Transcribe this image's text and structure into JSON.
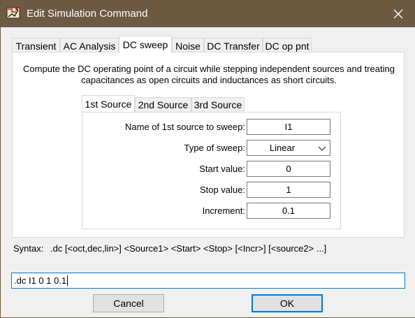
{
  "window": {
    "title": "Edit Simulation Command"
  },
  "tabs": [
    {
      "label": "Transient"
    },
    {
      "label": "AC Analysis"
    },
    {
      "label": "DC sweep"
    },
    {
      "label": "Noise"
    },
    {
      "label": "DC Transfer"
    },
    {
      "label": "DC op pnt"
    }
  ],
  "selected_tab": "DC sweep",
  "description": {
    "line1": "Compute the DC operating point of a circuit while stepping independent sources and treating",
    "line2": "capacitances as open circuits and inductances as short circuits."
  },
  "source_tabs": [
    {
      "label": "1st Source"
    },
    {
      "label": "2nd Source"
    },
    {
      "label": "3rd Source"
    }
  ],
  "selected_source_tab": "1st Source",
  "form": {
    "source_name": {
      "label": "Name of 1st source to sweep:",
      "value": "I1"
    },
    "sweep_type": {
      "label": "Type of sweep:",
      "value": "Linear"
    },
    "start": {
      "label": "Start value:",
      "value": "0"
    },
    "stop": {
      "label": "Stop value:",
      "value": "1"
    },
    "increment": {
      "label": "Increment:",
      "value": "0.1"
    }
  },
  "syntax": {
    "label": "Syntax:",
    "text": ".dc [<oct,dec,lin>] <Source1> <Start> <Stop> [<Incr>] [<source2> ...]"
  },
  "command": {
    "value": ".dc I1 0 1 0.1"
  },
  "buttons": {
    "cancel": "Cancel",
    "ok": "OK"
  },
  "icons": {
    "app": "ltspice-app-icon",
    "close": "close-icon",
    "dropdown": "chevron-down-icon"
  },
  "colors": {
    "titlebar": "#6e5a42",
    "focus_border": "#0078d7"
  }
}
